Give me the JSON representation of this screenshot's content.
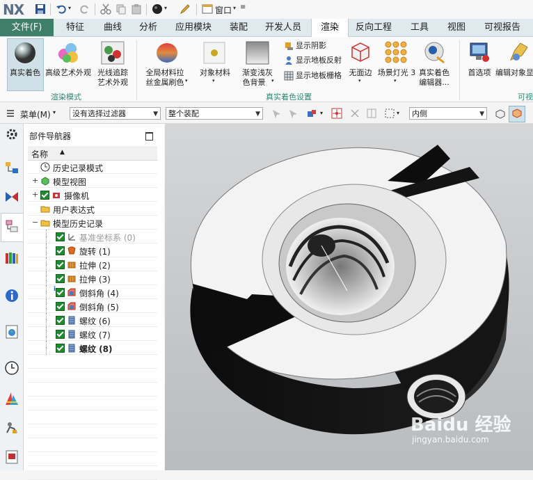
{
  "app": {
    "logo": "NX"
  },
  "quick_access": {
    "window_label": "窗口"
  },
  "tabs": [
    "文件(F)",
    "特征",
    "曲线",
    "分析",
    "应用模块",
    "装配",
    "开发人员",
    "渲染",
    "反向工程",
    "工具",
    "视图",
    "可视报告"
  ],
  "ribbon": {
    "true_shading": "真实着色",
    "advanced_art": "高级艺术外观",
    "ray_trace_1": "光线追踪",
    "ray_trace_2": "艺术外观",
    "group_render_mode": "渲染模式",
    "global_material_1": "全局材料拉",
    "global_material_2": "丝金属刷色",
    "object_material": "对象材料",
    "gradient_bg_1": "渐变浅灰",
    "gradient_bg_2": "色背景",
    "show_shadow": "显示阴影",
    "show_floor_reflect": "显示地板反射",
    "show_floor_grid": "显示地板栅格",
    "no_face": "无面边",
    "scene_light": "场景灯光 3",
    "shade_editor_1": "真实着色",
    "shade_editor_2": "编辑器...",
    "group_shading_settings": "真实着色设置",
    "preferences": "首选项",
    "edit_object_1": "编辑对象显",
    "group_visual": "可视"
  },
  "toolbar": {
    "menu": "菜单(M)",
    "filter": "没有选择过滤器",
    "assembly": "整个装配",
    "inside": "内侧"
  },
  "navigator": {
    "title": "部件导航器",
    "col_name": "名称",
    "rows": [
      {
        "label": "历史记录模式"
      },
      {
        "label": "模型视图"
      },
      {
        "label": "摄像机"
      },
      {
        "label": "用户表达式"
      },
      {
        "label": "模型历史记录"
      },
      {
        "label": "基准坐标系 (0)"
      },
      {
        "label": "旋转 (1)"
      },
      {
        "label": "拉伸 (2)"
      },
      {
        "label": "拉伸 (3)"
      },
      {
        "label": "倒斜角 (4)"
      },
      {
        "label": "倒斜角 (5)"
      },
      {
        "label": "螺纹 (6)"
      },
      {
        "label": "螺纹 (7)"
      },
      {
        "label": "螺纹 (8)"
      }
    ]
  },
  "watermark": {
    "brand": "Baidu 经验",
    "url": "jingyan.baidu.com"
  }
}
